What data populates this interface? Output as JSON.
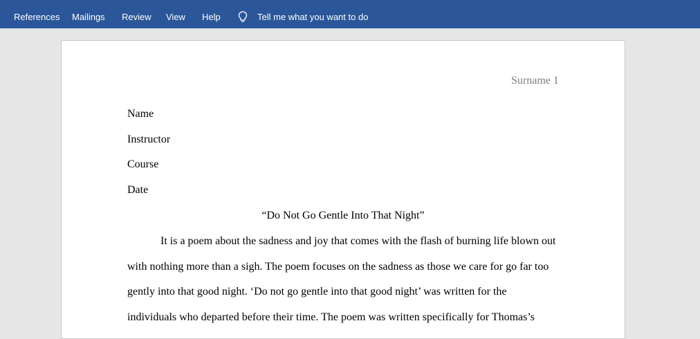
{
  "ribbon": {
    "tabs": [
      "References",
      "Mailings",
      "Review",
      "View",
      "Help"
    ],
    "tell_me": "Tell me what you want to do",
    "tell_me_icon": "lightbulb-icon",
    "background": "#2b579a"
  },
  "document": {
    "header": "Surname 1",
    "heading_lines": [
      "Name",
      "Instructor",
      "Course",
      "Date"
    ],
    "title": "“Do Not Go Gentle Into That Night”",
    "body_lines": [
      "It is a poem about the sadness and joy that comes with the flash of burning life blown out",
      "with nothing more than a sigh. The poem focuses on the sadness as those we care for go far too",
      "gently into that good night. ‘Do not go gentle into that good night’ was written for the",
      "individuals who departed before their time. The poem was written specifically for Thomas’s"
    ]
  }
}
